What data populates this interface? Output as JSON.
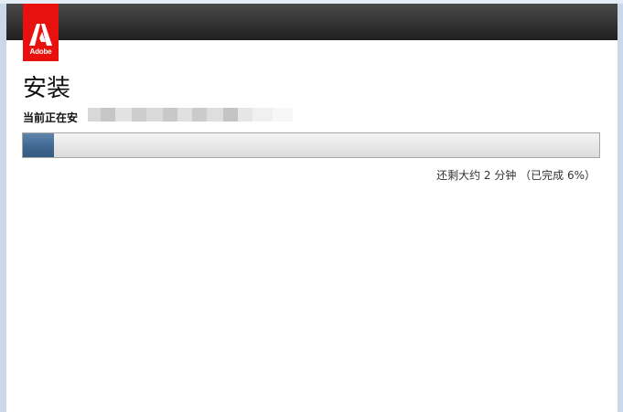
{
  "logo": {
    "text": "Adobe",
    "brand_color": "#e8110d",
    "icon": "adobe-logo-icon"
  },
  "header": {
    "color": "#333333"
  },
  "main": {
    "title": "安装",
    "status_label": "当前正在安",
    "progress": {
      "percent": 6,
      "text": "还剩大约 2 分钟 （已完成 6%）",
      "fill_color": "#436a94"
    }
  }
}
